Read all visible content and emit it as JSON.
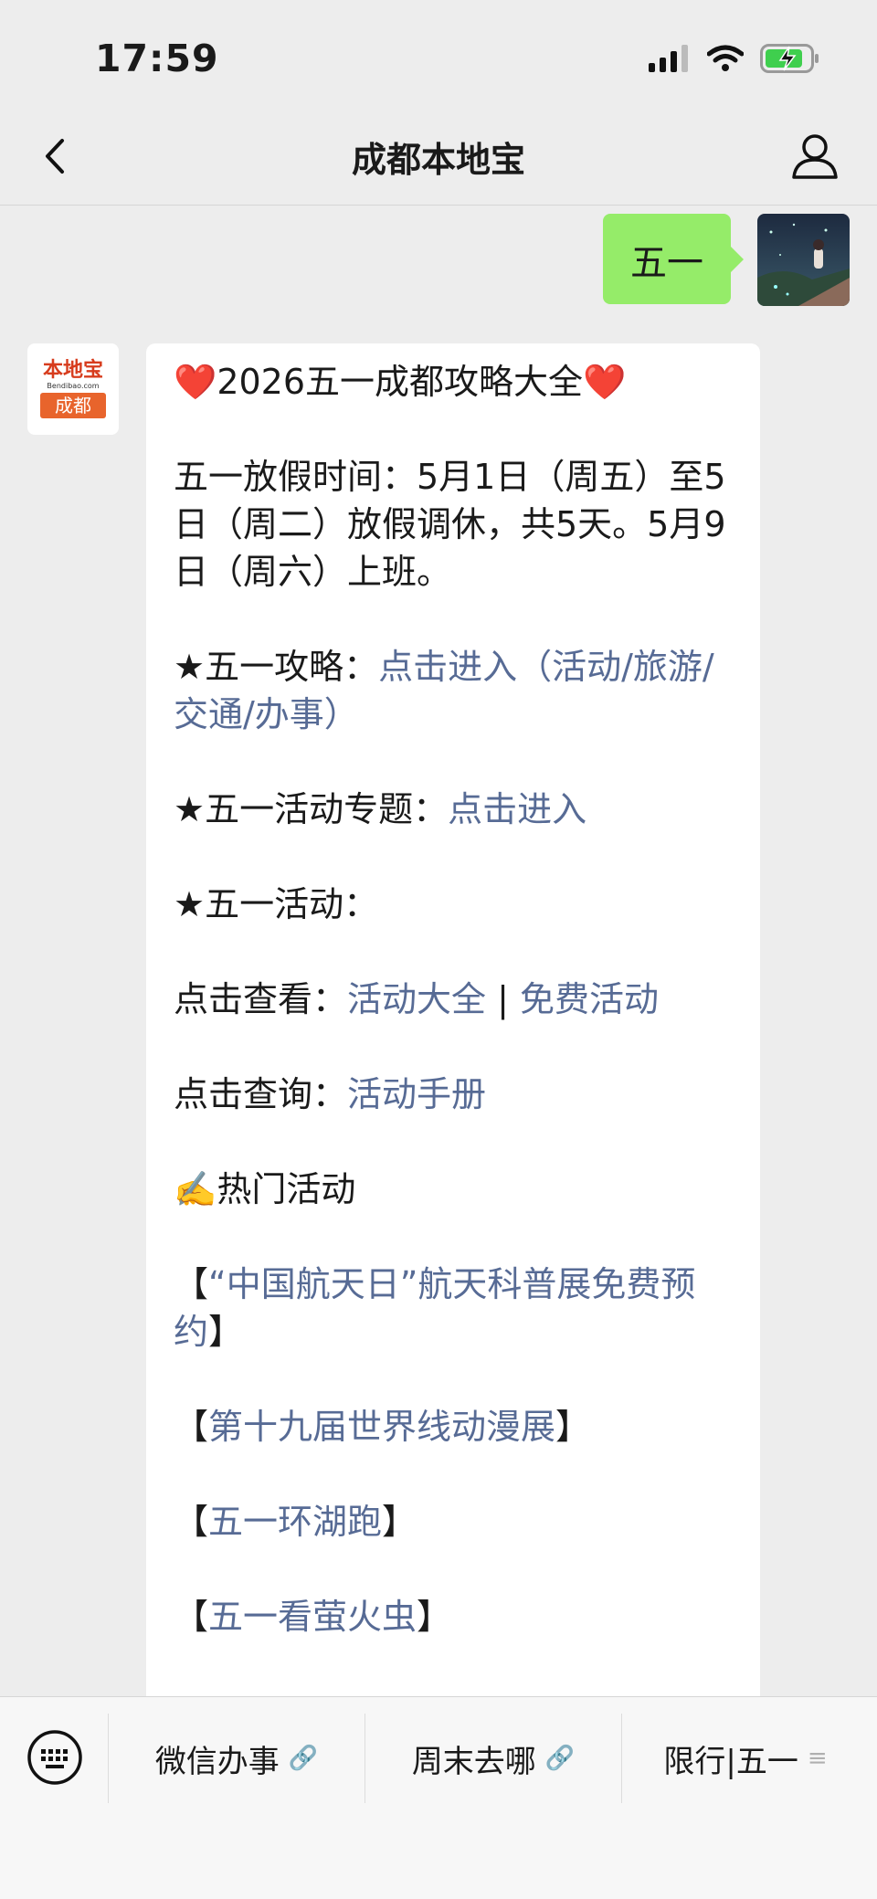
{
  "status_bar": {
    "time": "17:59"
  },
  "nav": {
    "title": "成都本地宝"
  },
  "messages": {
    "sent_text": "五一",
    "bot_logo": {
      "brand": "本地宝",
      "url": "Bendibao.com",
      "city": "成都"
    },
    "reply": {
      "heart": "❤️",
      "title": "2026五一成都攻略大全",
      "holiday": "五一放假时间：5月1日（周五）至5日（周二）放假调休，共5天。5月9日（周六）上班。",
      "guide_label": "★五一攻略：",
      "guide_link": "点击进入（活动/旅游/交通/办事）",
      "topic_label": "★五一活动专题：",
      "topic_link": "点击进入",
      "activity_label": "★五一活动：",
      "view_label": "点击查看：",
      "view_link_1": "活动大全",
      "view_sep": " | ",
      "view_link_2": "免费活动",
      "query_label": "点击查询：",
      "query_link": "活动手册",
      "hot_label": "✍️热门活动",
      "bracket_open": "【",
      "bracket_close": "】",
      "hot_1": "“中国航天日”航天科普展免费预约",
      "hot_2": "第十九届世界线动漫展",
      "hot_3": "五一环湖跑",
      "hot_4": "五一看萤火虫"
    }
  },
  "bottom_menu": {
    "items": [
      {
        "label": "微信办事",
        "icon": "link-icon"
      },
      {
        "label": "周末去哪",
        "icon": "link-icon"
      },
      {
        "label": "限行|五一",
        "icon": "menu-icon"
      }
    ]
  }
}
